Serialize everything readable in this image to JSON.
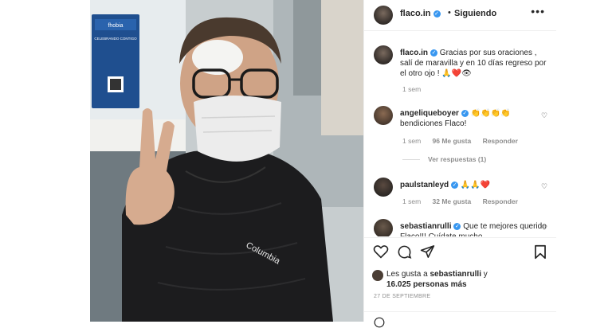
{
  "post": {
    "header": {
      "username": "flaco.in",
      "separator": "•",
      "follow_status": "Siguiendo",
      "more": "•••"
    },
    "caption": {
      "username": "flaco.in",
      "text": "Gracias por sus oraciones , salí de maravilla y en 10 días regreso por el otro ojo ! 🙏❤️👁",
      "time": "1 sem"
    },
    "comments": [
      {
        "username": "angeliqueboyer",
        "text": "👏👏👏👏 bendiciones Flaco!",
        "time": "1 sem",
        "likes": "96 Me gusta",
        "reply": "Responder",
        "view_replies": "Ver respuestas (1)"
      },
      {
        "username": "paulstanleyd",
        "text": "🙏🙏❤️",
        "time": "1 sem",
        "likes": "32 Me gusta",
        "reply": "Responder"
      },
      {
        "username": "sebastianrulli",
        "text": "Que te mejores querido Flaco!!! Cuídate mucho"
      }
    ],
    "liked_by": {
      "prefix": "Les gusta a",
      "user": "sebastianrulli",
      "joiner": "y",
      "others": "16.025 personas más"
    },
    "date": "27 DE SEPTIEMBRE",
    "photo": {
      "jacket_brand": "Columbia",
      "display_title": "fhobia",
      "display_text": "CELEBRANDO CONTIGO"
    }
  },
  "colors": {
    "verified": "#3897f0",
    "heart": "#ed4956",
    "muted": "#8e8e8e"
  },
  "icons": [
    "heart-icon",
    "comment-icon",
    "share-icon",
    "bookmark-icon",
    "more-icon",
    "verified-icon"
  ]
}
